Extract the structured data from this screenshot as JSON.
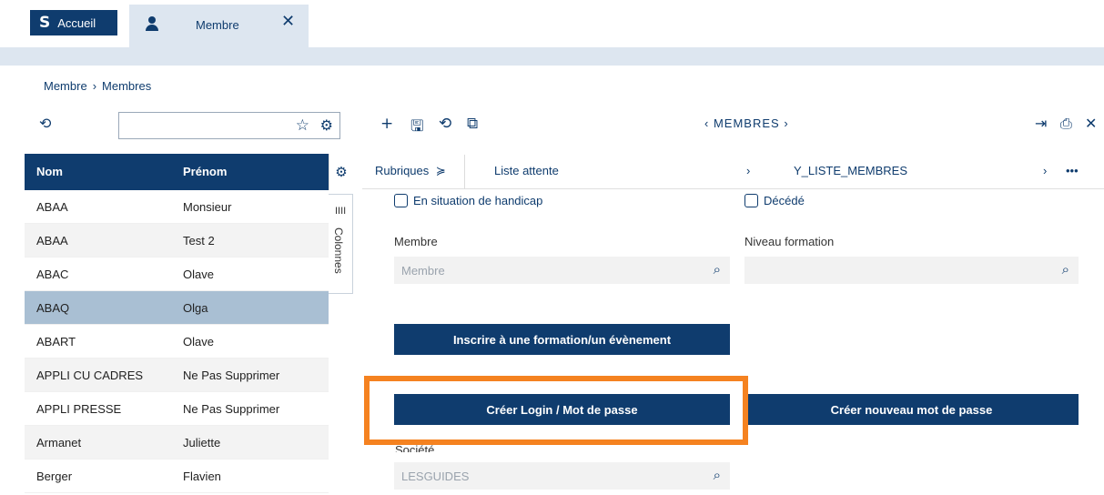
{
  "tabs": {
    "home_logo": "S",
    "home_label": "Accueil",
    "member_label": "Membre",
    "close_glyph": "✕"
  },
  "breadcrumb": {
    "part1": "Membre",
    "separator": "›",
    "part2": "Membres"
  },
  "left": {
    "refresh_glyph": "⟲",
    "search_value": "",
    "star_glyph": "☆",
    "search_settings_glyph": "⚙",
    "columns": [
      "Nom",
      "Prénom"
    ],
    "gear_glyph": "⚙",
    "colonnes_bars": "IIII",
    "colonnes_label": "Colonnes",
    "rows": [
      {
        "nom": "ABAA",
        "prenom": "Monsieur"
      },
      {
        "nom": "ABAA",
        "prenom": "Test 2"
      },
      {
        "nom": "ABAC",
        "prenom": "Olave"
      },
      {
        "nom": "ABAQ",
        "prenom": "Olga"
      },
      {
        "nom": "ABART",
        "prenom": "Olave"
      },
      {
        "nom": "APPLI CU CADRES",
        "prenom": "Ne Pas Supprimer"
      },
      {
        "nom": "APPLI PRESSE",
        "prenom": "Ne Pas Supprimer"
      },
      {
        "nom": "Armanet",
        "prenom": "Juliette"
      },
      {
        "nom": "Berger",
        "prenom": "Flavien"
      }
    ],
    "selected_index": 3
  },
  "toolbar": {
    "add_glyph": "+",
    "save_glyph": "🖫",
    "refresh_glyph": "⟲",
    "copy_glyph": "⧉",
    "nav_prev": "‹",
    "nav_title": "MEMBRES",
    "nav_next": "›",
    "export_glyph": "⇥",
    "print_glyph": "⎙",
    "close_glyph": "✕"
  },
  "subtabs": {
    "rubriques": "Rubriques",
    "rubriques_chevron": "≽",
    "liste_attente": "Liste attente",
    "arrow1": "›",
    "y_liste": "Y_LISTE_MEMBRES",
    "arrow2": "›",
    "more": "•••"
  },
  "form": {
    "handicap_label": "En situation de handicap",
    "decede_label": "Décédé",
    "membre_label": "Membre",
    "membre_placeholder": "Membre",
    "niveau_label": "Niveau formation",
    "niveau_value": "",
    "search_glyph": "⌕",
    "btn_inscrire": "Inscrire à une formation/un évènement",
    "btn_creer_login": "Créer Login / Mot de passe",
    "btn_nouveau_mdp": "Créer nouveau mot de passe",
    "societe_label": "Société",
    "societe_value": "LESGUIDES"
  },
  "colors": {
    "primary": "#0f3c6e",
    "selected_row": "#a9bfd3",
    "highlight": "#f58220"
  }
}
